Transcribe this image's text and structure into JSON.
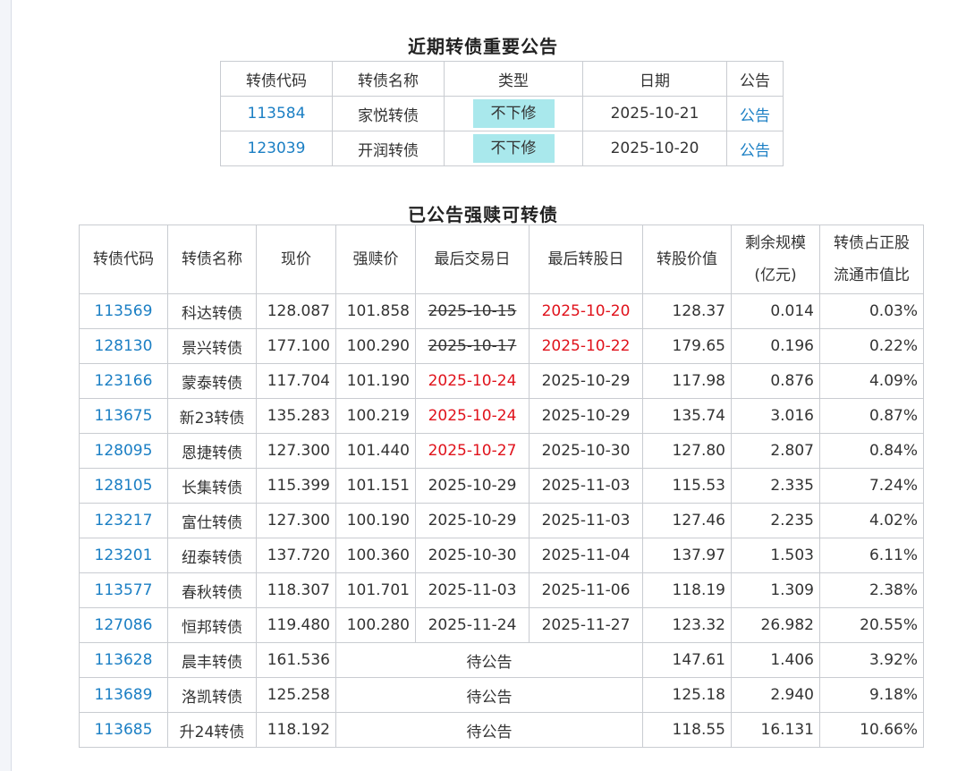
{
  "section1": {
    "title": "近期转债重要公告",
    "headers": [
      "转债代码",
      "转债名称",
      "类型",
      "日期",
      "公告"
    ],
    "rows": [
      {
        "code": "113584",
        "name": "家悦转债",
        "type": "不下修",
        "date": "2025-10-21",
        "notice": "公告"
      },
      {
        "code": "123039",
        "name": "开润转债",
        "type": "不下修",
        "date": "2025-10-20",
        "notice": "公告"
      }
    ],
    "badge_color": "#a9e8ec",
    "link_color": "#1b7fc4"
  },
  "section2": {
    "title": "已公告强赎可转债",
    "headers": {
      "code": "转债代码",
      "name": "转债名称",
      "price": "现价",
      "redeem": "强赎价",
      "last_trade": "最后交易日",
      "last_convert": "最后转股日",
      "conv_value": "转股价值",
      "remain_line1": "剩余规模",
      "remain_line2": "(亿元)",
      "ratio_line1": "转债占正股",
      "ratio_line2": "流通市值比"
    },
    "pending_label": "待公告",
    "rows": [
      {
        "code": "113569",
        "name": "科达转债",
        "price": "128.087",
        "redeem": "101.858",
        "last_trade": "2025-10-15",
        "last_trade_style": "strike",
        "last_convert": "2025-10-20",
        "last_convert_style": "red",
        "conv_value": "128.37",
        "remain": "0.014",
        "ratio": "0.03%"
      },
      {
        "code": "128130",
        "name": "景兴转债",
        "price": "177.100",
        "redeem": "100.290",
        "last_trade": "2025-10-17",
        "last_trade_style": "strike",
        "last_convert": "2025-10-22",
        "last_convert_style": "red",
        "conv_value": "179.65",
        "remain": "0.196",
        "ratio": "0.22%"
      },
      {
        "code": "123166",
        "name": "蒙泰转债",
        "price": "117.704",
        "redeem": "101.190",
        "last_trade": "2025-10-24",
        "last_trade_style": "red",
        "last_convert": "2025-10-29",
        "last_convert_style": "normal",
        "conv_value": "117.98",
        "remain": "0.876",
        "ratio": "4.09%"
      },
      {
        "code": "113675",
        "name": "新23转债",
        "price": "135.283",
        "redeem": "100.219",
        "last_trade": "2025-10-24",
        "last_trade_style": "red",
        "last_convert": "2025-10-29",
        "last_convert_style": "normal",
        "conv_value": "135.74",
        "remain": "3.016",
        "ratio": "0.87%"
      },
      {
        "code": "128095",
        "name": "恩捷转债",
        "price": "127.300",
        "redeem": "101.440",
        "last_trade": "2025-10-27",
        "last_trade_style": "red",
        "last_convert": "2025-10-30",
        "last_convert_style": "normal",
        "conv_value": "127.80",
        "remain": "2.807",
        "ratio": "0.84%"
      },
      {
        "code": "128105",
        "name": "长集转债",
        "price": "115.399",
        "redeem": "101.151",
        "last_trade": "2025-10-29",
        "last_trade_style": "normal",
        "last_convert": "2025-11-03",
        "last_convert_style": "normal",
        "conv_value": "115.53",
        "remain": "2.335",
        "ratio": "7.24%"
      },
      {
        "code": "123217",
        "name": "富仕转债",
        "price": "127.300",
        "redeem": "100.190",
        "last_trade": "2025-10-29",
        "last_trade_style": "normal",
        "last_convert": "2025-11-03",
        "last_convert_style": "normal",
        "conv_value": "127.46",
        "remain": "2.235",
        "ratio": "4.02%"
      },
      {
        "code": "123201",
        "name": "纽泰转债",
        "price": "137.720",
        "redeem": "100.360",
        "last_trade": "2025-10-30",
        "last_trade_style": "normal",
        "last_convert": "2025-11-04",
        "last_convert_style": "normal",
        "conv_value": "137.97",
        "remain": "1.503",
        "ratio": "6.11%"
      },
      {
        "code": "113577",
        "name": "春秋转债",
        "price": "118.307",
        "redeem": "101.701",
        "last_trade": "2025-11-03",
        "last_trade_style": "normal",
        "last_convert": "2025-11-06",
        "last_convert_style": "normal",
        "conv_value": "118.19",
        "remain": "1.309",
        "ratio": "2.38%"
      },
      {
        "code": "127086",
        "name": "恒邦转债",
        "price": "119.480",
        "redeem": "100.280",
        "last_trade": "2025-11-24",
        "last_trade_style": "normal",
        "last_convert": "2025-11-27",
        "last_convert_style": "normal",
        "conv_value": "123.32",
        "remain": "26.982",
        "ratio": "20.55%"
      },
      {
        "code": "113628",
        "name": "晨丰转债",
        "price": "161.536",
        "pending": true,
        "conv_value": "147.61",
        "remain": "1.406",
        "ratio": "3.92%"
      },
      {
        "code": "113689",
        "name": "洛凯转债",
        "price": "125.258",
        "pending": true,
        "conv_value": "125.18",
        "remain": "2.940",
        "ratio": "9.18%"
      },
      {
        "code": "113685",
        "name": "升24转债",
        "price": "118.192",
        "pending": true,
        "conv_value": "118.55",
        "remain": "16.131",
        "ratio": "10.66%"
      }
    ],
    "red_color": "#e0121b"
  }
}
